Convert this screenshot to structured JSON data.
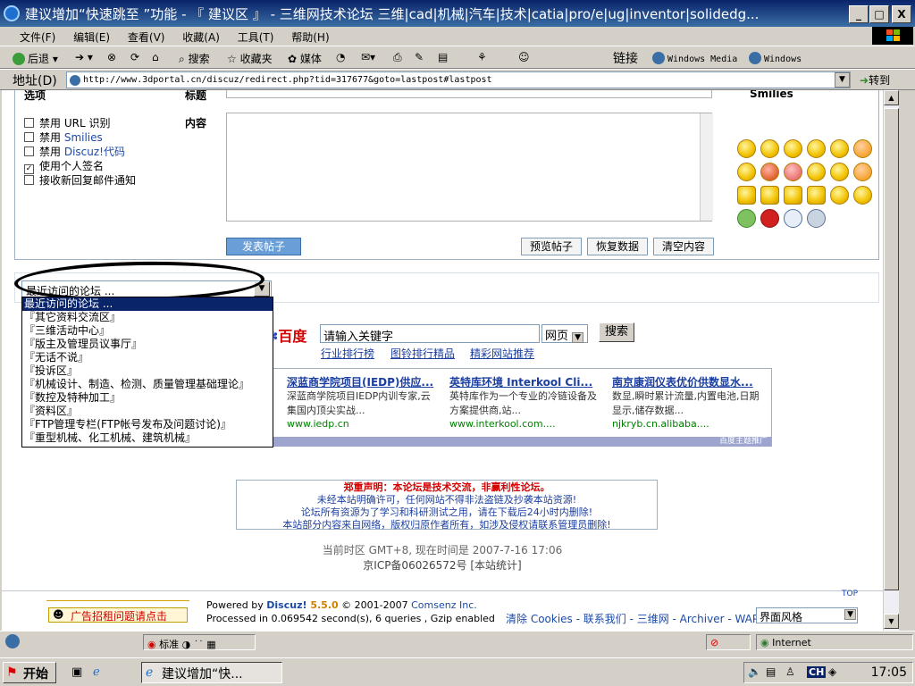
{
  "window": {
    "title": "建议增加“快速跳至 ”功能 - 『 建议区 』 - 三维网技术论坛 三维|cad|机械|汽车|技术|catia|pro/e|ug|inventor|solidedg...",
    "btn_min": "_",
    "btn_max": "□",
    "btn_close": "X"
  },
  "menubar": [
    "文件(F)",
    "编辑(E)",
    "查看(V)",
    "收藏(A)",
    "工具(T)",
    "帮助(H)"
  ],
  "toolbar": {
    "back": "后退",
    "search": "搜索",
    "favorites": "收藏夹",
    "media": "媒体",
    "links": "链接",
    "link1": "Windows Media",
    "link2": "Windows"
  },
  "address": {
    "label": "地址(D)",
    "url": "http://www.3dportal.cn/discuz/redirect.php?tid=317677&goto=lastpost#lastpost",
    "go": "转到"
  },
  "form": {
    "label_options": "选项",
    "label_title": "标题",
    "label_content": "内容",
    "label_smilies": "Smilies",
    "options": [
      {
        "prefix": "禁用 ",
        "suffix": "URL 识别",
        "checked": ""
      },
      {
        "prefix": "禁用 ",
        "suffix": "Smilies",
        "checked": ""
      },
      {
        "prefix": "禁用 ",
        "suffix": "Discuz!代码",
        "checked": ""
      },
      {
        "prefix": "使用个人签名",
        "suffix": "",
        "checked": "✓"
      },
      {
        "prefix": "接收新回复邮件通知",
        "suffix": "",
        "checked": ""
      }
    ],
    "submit": "发表帖子",
    "preview": "预览帖子",
    "restore": "恢复数据",
    "clear": "清空内容"
  },
  "forum_jump": {
    "selected": "最近访问的论坛 ...",
    "options": [
      "最近访问的论坛 ...",
      "『其它资料交流区』",
      "『三维活动中心』",
      "『版主及管理员议事厅』",
      "『无话不说』",
      "『投诉区』",
      "『机械设计、制造、检测、质量管理基础理论』",
      "『数控及特种加工』",
      "『资料区』",
      "『FTP管理专栏(FTP帐号发布及问题讨论)』",
      "『重型机械、化工机械、建筑机械』"
    ]
  },
  "baidu": {
    "logo": "百度",
    "placeholder": "请输入关键字",
    "select": "网页",
    "button": "搜索",
    "links": [
      "行业排行榜",
      "图铃排行精品",
      "精彩网站推荐"
    ]
  },
  "ads": [
    {
      "title": "深蓝商学院项目(IEDP)供应...",
      "desc": "深蓝商学院项目IEDP内训专家,云集国内顶尖实战...",
      "url": "www.iedp.cn"
    },
    {
      "title": "英特库环境 Interkool Cli...",
      "desc": "英特库作为一个专业的冷链设备及方案提供商,站...",
      "url": "www.interkool.com...."
    },
    {
      "title": "南京康润仪表优价供数显水...",
      "desc": "数显,瞬时累计流量,内置电池,日期显示,储存数据...",
      "url": "njkryb.cn.alibaba...."
    }
  ],
  "ads_footer": "百度主题推广",
  "notice": {
    "title": "郑重声明：本论坛是技术交流，非赢利性论坛。",
    "lines": [
      "未经本站明确许可，任何网站不得非法盗链及抄袭本站资源!",
      "论坛所有资源为了学习和科研测试之用，请在下载后24小时内删除!",
      "本站部分内容来自网络，版权归原作者所有，如涉及侵权请联系管理员删除!"
    ]
  },
  "footer": {
    "time": "当前时区 GMT+8, 现在时间是 2007-7-16 17:06",
    "icp": "京ICP备06026572号 [本站统计]",
    "top": "TOP",
    "ad_button": "广告招租问题请点击",
    "powered_prefix": "Powered by ",
    "powered_brand": "Discuz!",
    "powered_version": " 5.5.0",
    "copyright_prefix": "© 2001-2007 ",
    "copyright_company": "Comsenz Inc.",
    "processed": "Processed in 0.069542 second(s), 6 queries , Gzip enabled",
    "links": "清除 Cookies - 联系我们 - 三维网 - Archiver - WAP",
    "skin": "界面风格"
  },
  "status": {
    "ime": "标准",
    "zone": "Internet"
  },
  "taskbar": {
    "start": "开始",
    "task": "建议增加“快...",
    "ime": "CH",
    "clock": "17:05"
  }
}
